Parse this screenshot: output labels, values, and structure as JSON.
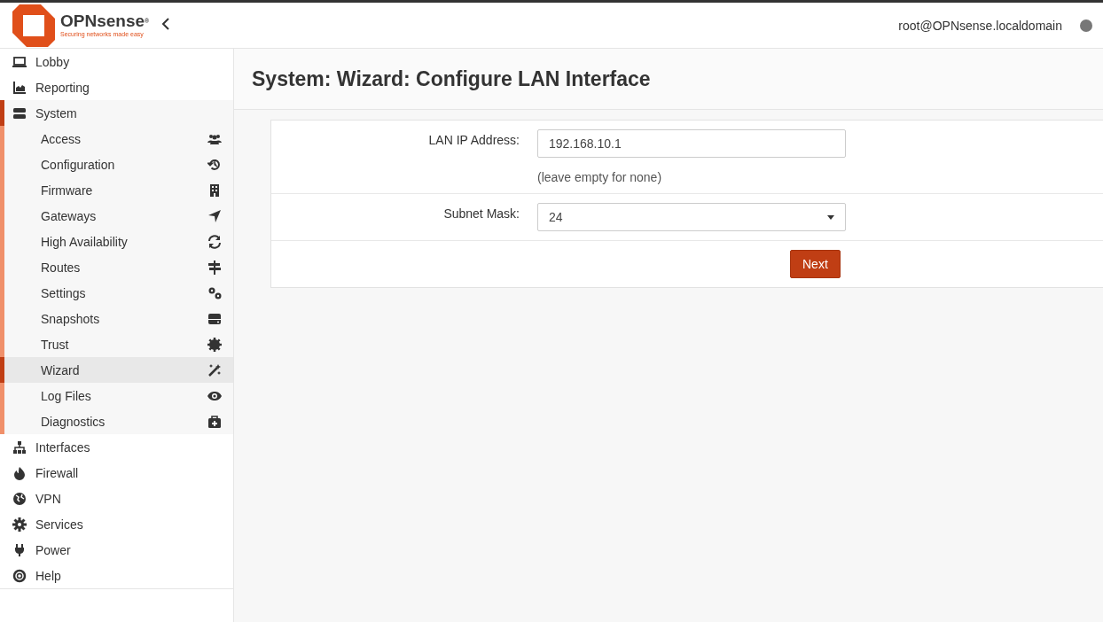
{
  "header": {
    "logo_name": "OPNsense",
    "logo_registered": "®",
    "logo_tagline": "Securing networks made easy",
    "user": "root@OPNsense.localdomain"
  },
  "sidebar": {
    "items": [
      {
        "label": "Lobby",
        "expanded": false
      },
      {
        "label": "Reporting",
        "expanded": false
      },
      {
        "label": "System",
        "expanded": true,
        "children": [
          {
            "label": "Access",
            "selected": false
          },
          {
            "label": "Configuration",
            "selected": false
          },
          {
            "label": "Firmware",
            "selected": false
          },
          {
            "label": "Gateways",
            "selected": false
          },
          {
            "label": "High Availability",
            "selected": false
          },
          {
            "label": "Routes",
            "selected": false
          },
          {
            "label": "Settings",
            "selected": false
          },
          {
            "label": "Snapshots",
            "selected": false
          },
          {
            "label": "Trust",
            "selected": false
          },
          {
            "label": "Wizard",
            "selected": true
          },
          {
            "label": "Log Files",
            "selected": false
          },
          {
            "label": "Diagnostics",
            "selected": false
          }
        ]
      },
      {
        "label": "Interfaces",
        "expanded": false
      },
      {
        "label": "Firewall",
        "expanded": false
      },
      {
        "label": "VPN",
        "expanded": false
      },
      {
        "label": "Services",
        "expanded": false
      },
      {
        "label": "Power",
        "expanded": false
      },
      {
        "label": "Help",
        "expanded": false
      }
    ]
  },
  "page": {
    "title": "System: Wizard: Configure LAN Interface",
    "form": {
      "rows": [
        {
          "kind": "text",
          "label": "LAN IP Address:",
          "value": "192.168.10.1",
          "hint": "(leave empty for none)"
        },
        {
          "kind": "select",
          "label": "Subnet Mask:",
          "value": "24"
        }
      ],
      "button": "Next"
    }
  }
}
